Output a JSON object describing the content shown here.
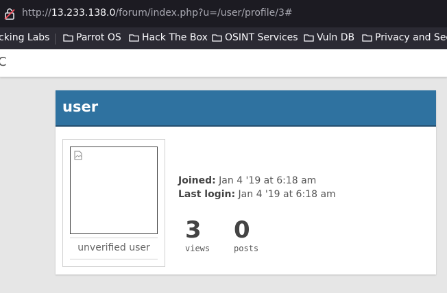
{
  "browser": {
    "url_prefix": "http://",
    "url_host": "13.233.138.0",
    "url_path": "/forum/index.php?u=/user/profile/3#"
  },
  "bookmarks": [
    {
      "label": "cking Labs"
    },
    {
      "label": "Parrot OS"
    },
    {
      "label": "Hack The Box"
    },
    {
      "label": "OSINT Services"
    },
    {
      "label": "Vuln DB"
    },
    {
      "label": "Privacy and Secu"
    }
  ],
  "page": {
    "brand_fragment": "C"
  },
  "profile": {
    "username": "user",
    "avatar_caption": "unverified user",
    "joined_label": "Joined:",
    "joined_value": "Jan 4 '19 at 6:18 am",
    "last_login_label": "Last login:",
    "last_login_value": "Jan 4 '19 at 6:18 am",
    "views_count": "3",
    "views_label": "views",
    "posts_count": "0",
    "posts_label": "posts"
  },
  "colors": {
    "header_blue": "#2f72a0",
    "browser_bar": "#1c1b22",
    "bookmarks_bar": "#2b2a33"
  }
}
